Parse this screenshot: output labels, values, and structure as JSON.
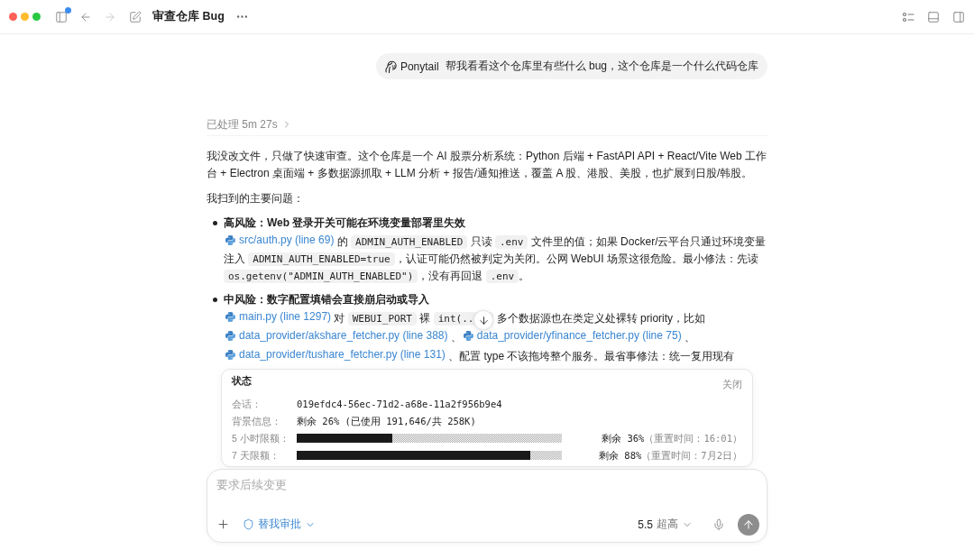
{
  "window": {
    "title": "审查仓库 Bug"
  },
  "toolbar": {
    "sidebar_notification": true,
    "back_disabled": false,
    "forward_disabled": true
  },
  "user_message": {
    "mention": "Ponytail",
    "text": "帮我看看这个仓库里有些什么 bug，这个仓库是一个什么代码仓库"
  },
  "processed": {
    "label": "已处理",
    "duration": "5m 27s",
    "expanded": false
  },
  "answer": {
    "intro": "我没改文件，只做了快速审查。这个仓库是一个 AI 股票分析系统：Python 后端 + FastAPI API + React/Vite Web 工作台 + Electron 桌面端 + 多数据源抓取 + LLM 分析 + 报告/通知推送，覆盖 A 股、港股、美股，也扩展到日股/韩股。",
    "list_heading": "我扫到的主要问题：",
    "issues": [
      {
        "title": "高风险：Web 登录开关可能在环境变量部署里失效",
        "body": [
          {
            "kind": "link",
            "text": "src/auth.py (line 69)"
          },
          {
            "kind": "text",
            "text": " 的 "
          },
          {
            "kind": "code",
            "text": "ADMIN_AUTH_ENABLED"
          },
          {
            "kind": "text",
            "text": " 只读 "
          },
          {
            "kind": "code",
            "text": ".env"
          },
          {
            "kind": "text",
            "text": " 文件里的值；如果 Docker/云平台只通过环境变量注入 "
          },
          {
            "kind": "code",
            "text": "ADMIN_AUTH_ENABLED=true"
          },
          {
            "kind": "text",
            "text": "，认证可能仍然被判定为关闭。公网 WebUI 场景这很危险。最小修法：先读 "
          },
          {
            "kind": "code",
            "text": "os.getenv(\"ADMIN_AUTH_ENABLED\")"
          },
          {
            "kind": "text",
            "text": "，没有再回退 "
          },
          {
            "kind": "code",
            "text": ".env"
          },
          {
            "kind": "text",
            "text": "。"
          }
        ]
      },
      {
        "title": "中风险：数字配置填错会直接崩启动或导入",
        "body": [
          {
            "kind": "link",
            "text": "main.py (line 1297)"
          },
          {
            "kind": "text",
            "text": " 对 "
          },
          {
            "kind": "code",
            "text": "WEBUI_PORT"
          },
          {
            "kind": "text",
            "text": " 裸 "
          },
          {
            "kind": "code",
            "text": "int(..",
            "covered": true
          },
          {
            "kind": "text",
            "text": " 多个数据源也在类定义处裸转 priority，比如 "
          },
          {
            "kind": "link",
            "text": "data_provider/akshare_fetcher.py (line 388)"
          },
          {
            "kind": "text",
            "text": " 、"
          },
          {
            "kind": "link",
            "text": "data_provider/yfinance_fetcher.py (line 75)"
          },
          {
            "kind": "text",
            "text": " 、"
          },
          {
            "kind": "link",
            "text": "data_provider/tushare_fetcher.py (line 131)"
          },
          {
            "kind": "text",
            "text": " 、配置 type 不该拖垮整个服务。最省事修法：统一复用现有"
          }
        ]
      }
    ]
  },
  "status": {
    "title": "状态",
    "close": "关闭",
    "rows": [
      {
        "kind": "text",
        "label": "会话：",
        "value": "019efdc4-56ec-71d2-a68e-11a2f956b9e4"
      },
      {
        "kind": "text",
        "label": "背景信息：",
        "value": "剩余 26% (已使用 191,646/共 258K)"
      },
      {
        "kind": "meter",
        "label": "5 小时限额：",
        "level": 0.36,
        "remaining": "剩余 36%",
        "reset": "（重置时间：16:01）"
      },
      {
        "kind": "meter",
        "label": "7 天限额：",
        "level": 0.88,
        "remaining": "剩余 88%",
        "reset": "（重置时间：7月2日）"
      }
    ]
  },
  "composer": {
    "placeholder": "要求后续变更",
    "approval": "替我审批",
    "model_version": "5.5",
    "effort": "超高"
  }
}
